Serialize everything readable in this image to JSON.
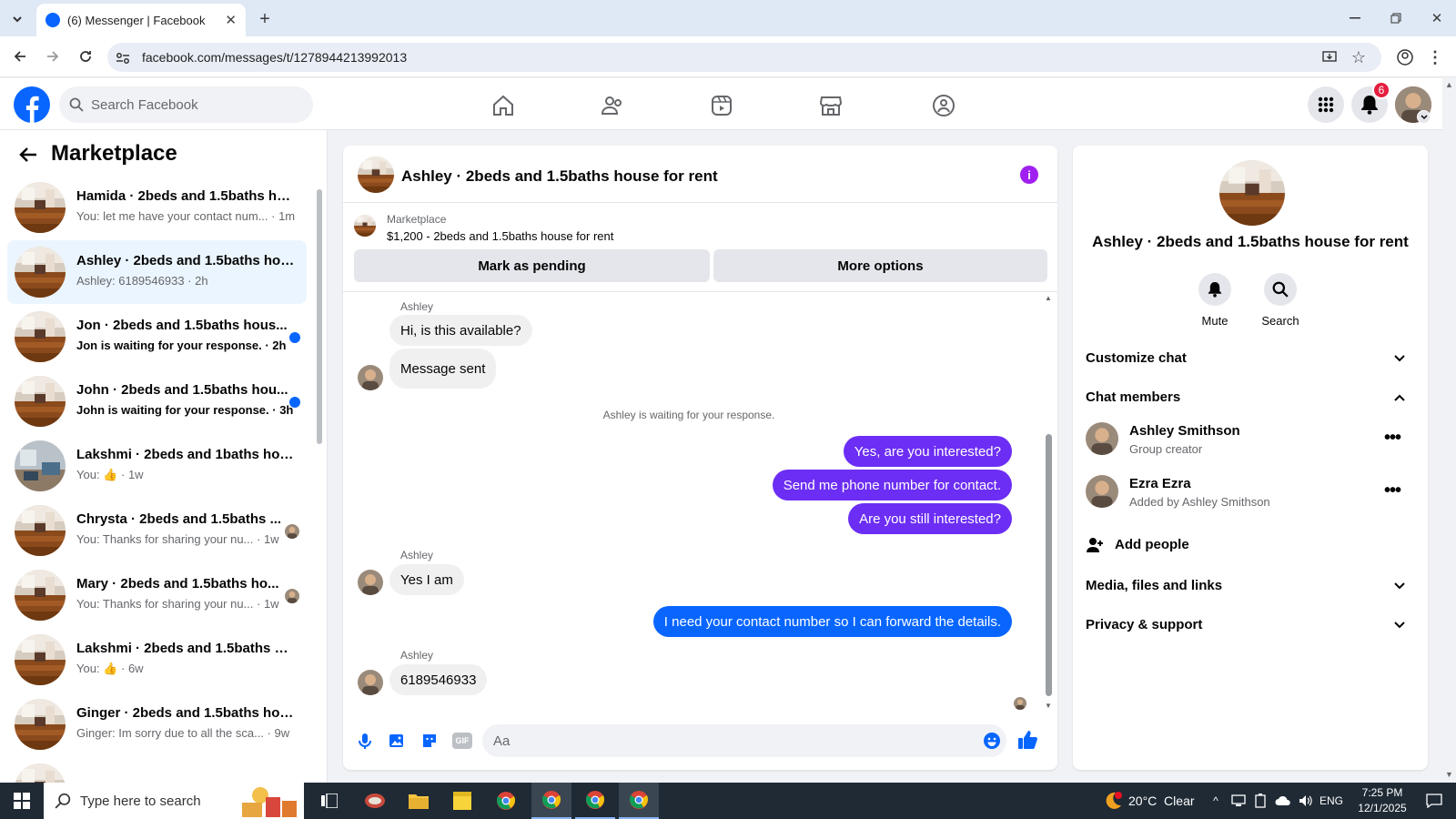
{
  "browser": {
    "tab_title": "(6) Messenger | Facebook",
    "url": "facebook.com/messages/t/1278944213992013"
  },
  "header": {
    "search_placeholder": "Search Facebook",
    "notification_count": "6"
  },
  "sidebar": {
    "title": "Marketplace",
    "conversations": [
      {
        "title": "Hamida · 2beds and 1.5baths ho...",
        "preview": "You: let me have your contact num... · 1m",
        "unread": false
      },
      {
        "title": "Ashley · 2beds and 1.5baths hou...",
        "preview": "Ashley: 6189546933 · 2h",
        "unread": false,
        "active": true
      },
      {
        "title": "Jon · 2beds and 1.5baths hous...",
        "preview": "Jon is waiting for your response. · 2h",
        "unread": true
      },
      {
        "title": "John · 2beds and 1.5baths hou...",
        "preview": "John is waiting for your response. · 3h",
        "unread": true
      },
      {
        "title": "Lakshmi · 2beds and 1baths hou...",
        "preview_prefix": "You:",
        "preview_suffix": "· 1w",
        "unread": false
      },
      {
        "title": "Chrysta · 2beds and 1.5baths ...",
        "preview": "You: Thanks for sharing your nu... · 1w",
        "unread": false
      },
      {
        "title": "Mary · 2beds and 1.5baths ho...",
        "preview": "You: Thanks for sharing your nu... · 1w",
        "unread": false
      },
      {
        "title": "Lakshmi · 2beds and 1.5baths ho...",
        "preview_prefix": "You:",
        "preview_suffix": "· 6w",
        "unread": false
      },
      {
        "title": "Ginger · 2beds and 1.5baths hou...",
        "preview": "Ginger: Im sorry due to all the sca... · 9w",
        "unread": false
      }
    ]
  },
  "chat": {
    "title": "Ashley · 2beds and 1.5baths house for rent",
    "listing_label": "Marketplace",
    "listing_detail": "$1,200 - 2beds and 1.5baths house for rent",
    "mark_pending": "Mark as pending",
    "more_options": "More options",
    "messages": [
      {
        "sender": "Ashley",
        "text": "Hi, is this available?"
      },
      {
        "text": "Message sent"
      },
      {
        "system": "Ashley is waiting for your response."
      },
      {
        "text": "Yes, are you interested?"
      },
      {
        "text": "Send me phone number for contact."
      },
      {
        "text": "Are you still interested?"
      },
      {
        "sender": "Ashley",
        "text": "Yes I am"
      },
      {
        "text": "I need your contact number so I can forward the details."
      },
      {
        "sender": "Ashley",
        "text": "6189546933"
      }
    ],
    "composer_placeholder": "Aa"
  },
  "info": {
    "title": "Ashley · 2beds and 1.5baths house for rent",
    "mute_label": "Mute",
    "search_label": "Search",
    "customize_chat": "Customize chat",
    "chat_members": "Chat members",
    "members": [
      {
        "name": "Ashley Smithson",
        "role": "Group creator"
      },
      {
        "name": "Ezra Ezra",
        "role": "Added by Ashley Smithson"
      }
    ],
    "add_people": "Add people",
    "media": "Media, files and links",
    "privacy": "Privacy & support"
  },
  "taskbar": {
    "search_placeholder": "Type here to search",
    "weather": "20°C  Clear",
    "language": "ENG",
    "time": "7:25 PM",
    "date": "12/1/2025"
  },
  "colors": {
    "brand": "#0866ff",
    "outgoing_bubble": "#6c2ef4",
    "info_icon": "#a020f0"
  }
}
